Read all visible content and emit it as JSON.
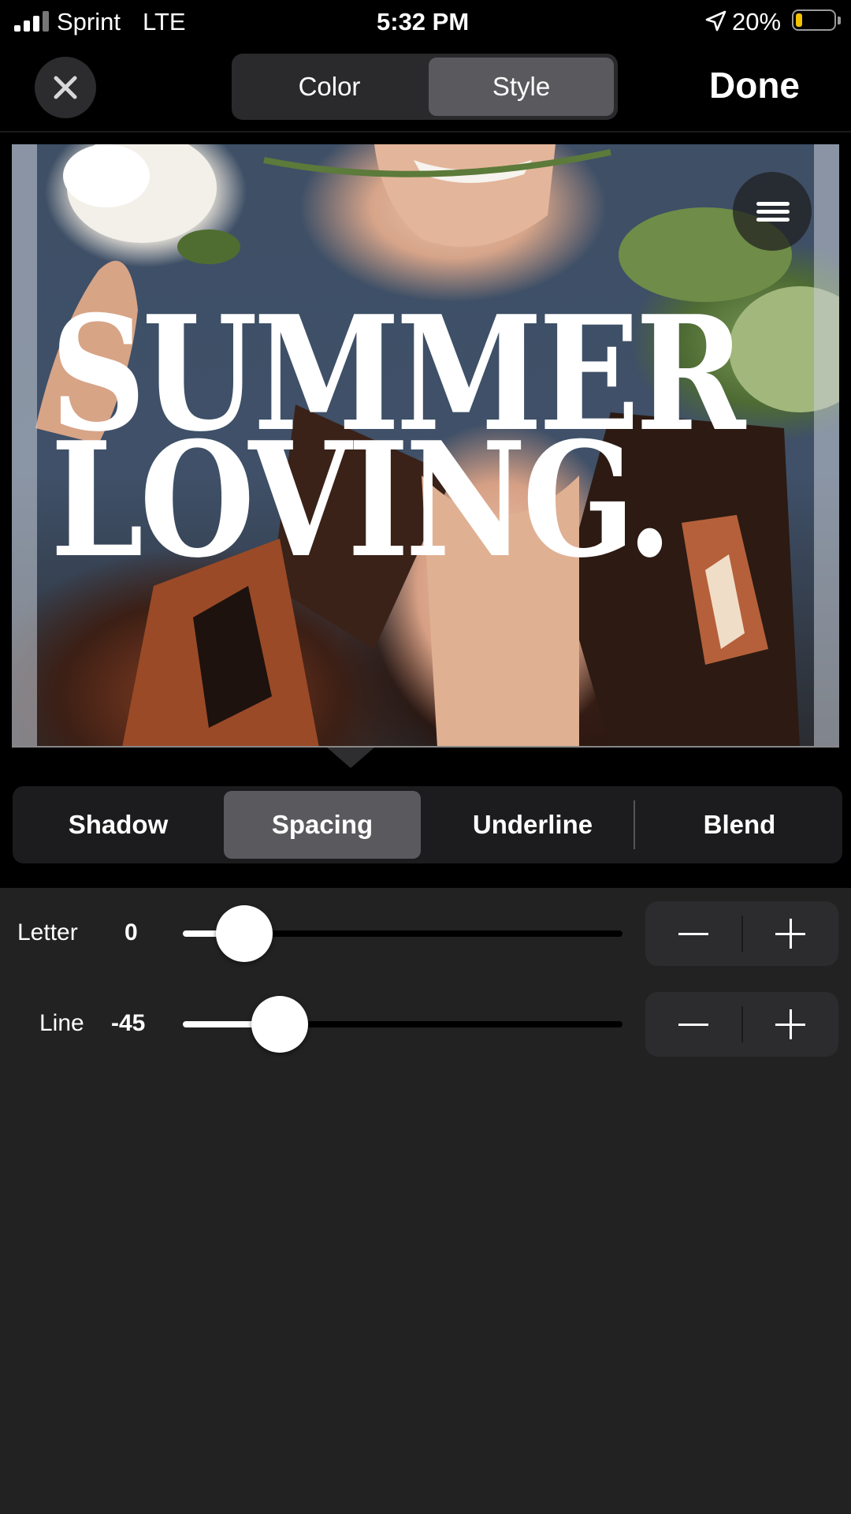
{
  "status_bar": {
    "carrier": "Sprint",
    "network": "LTE",
    "time": "5:32 PM",
    "battery": "20%",
    "icons": [
      "signal-icon",
      "location-arrow-icon",
      "battery-icon"
    ]
  },
  "header": {
    "close_icon": "close-icon",
    "segments": [
      "Color",
      "Style"
    ],
    "selected_segment": "Style",
    "done_label": "Done"
  },
  "canvas": {
    "headline_line1": "SUMMER",
    "headline_line2": "LOVING.",
    "menu_icon": "hamburger-menu-icon"
  },
  "style_tabs": {
    "tabs": [
      "Shadow",
      "Spacing",
      "Underline",
      "Blend"
    ],
    "selected": "Spacing"
  },
  "spacing": {
    "letter": {
      "label": "Letter",
      "value": "0",
      "slider_fraction": 0.14
    },
    "line": {
      "label": "Line",
      "value": "-45",
      "slider_fraction": 0.22
    },
    "stepper_icons": [
      "minus-icon",
      "plus-icon"
    ]
  },
  "colors": {
    "background": "#222222",
    "selected_segment": "#5a5a5e",
    "text": "#ffffff",
    "battery_low": "#f2c200"
  }
}
